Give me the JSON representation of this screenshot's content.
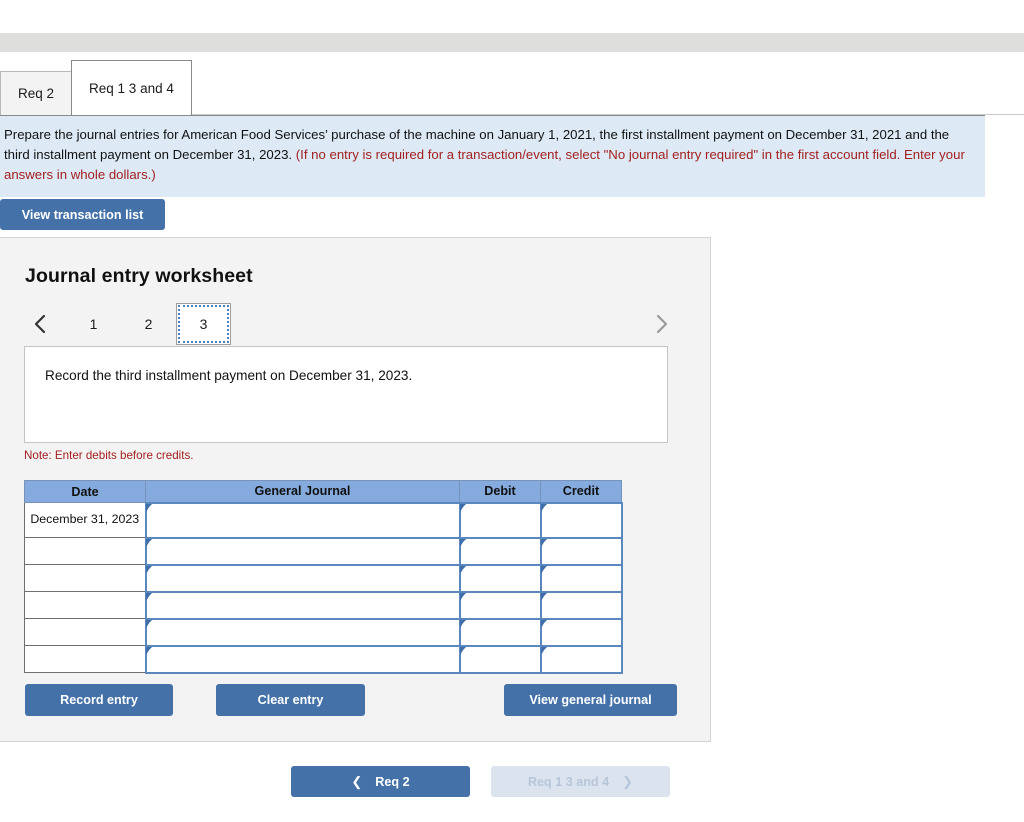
{
  "tabs": [
    {
      "label": "Req 2",
      "active": false
    },
    {
      "label": "Req 1 3 and 4",
      "active": true
    }
  ],
  "instruction": {
    "main": "Prepare the journal entries for American Food Services’ purchase of the machine on January 1, 2021, the first installment payment on December 31, 2021 and the third installment payment on December 31, 2023.",
    "hint": "(If no entry is required for a transaction/event, select \"No journal entry required\" in the first account field. Enter your answers in whole dollars.)"
  },
  "toolbar": {
    "view_transaction_list": "View transaction list"
  },
  "worksheet": {
    "title": "Journal entry worksheet",
    "pager": {
      "prev_icon": "chevron-left-icon",
      "next_icon": "chevron-right-icon",
      "pages": [
        "1",
        "2",
        "3"
      ],
      "active_page": "3"
    },
    "description": "Record the third installment payment on December 31, 2023.",
    "note": "Note: Enter debits before credits.",
    "table": {
      "headers": [
        "Date",
        "General Journal",
        "Debit",
        "Credit"
      ],
      "rows": [
        {
          "date": "December 31, 2023",
          "general_journal": "",
          "debit": "",
          "credit": ""
        },
        {
          "date": "",
          "general_journal": "",
          "debit": "",
          "credit": ""
        },
        {
          "date": "",
          "general_journal": "",
          "debit": "",
          "credit": ""
        },
        {
          "date": "",
          "general_journal": "",
          "debit": "",
          "credit": ""
        },
        {
          "date": "",
          "general_journal": "",
          "debit": "",
          "credit": ""
        },
        {
          "date": "",
          "general_journal": "",
          "debit": "",
          "credit": ""
        }
      ]
    },
    "actions": {
      "record_entry": "Record entry",
      "clear_entry": "Clear entry",
      "view_general_journal": "View general journal"
    }
  },
  "bottom_nav": {
    "prev_label": "Req 2",
    "next_label": "Req 1 3 and 4",
    "next_disabled": true
  },
  "colors": {
    "accent": "#4472a8",
    "banner_bg": "#ddeaf6",
    "hint_text": "#a32020",
    "table_header_bg": "#85aadd",
    "input_border": "#5b87bf",
    "panel_bg": "#f3f3f3",
    "top_strip": "#dededd",
    "nav_disabled_bg": "#dbe4ee"
  }
}
